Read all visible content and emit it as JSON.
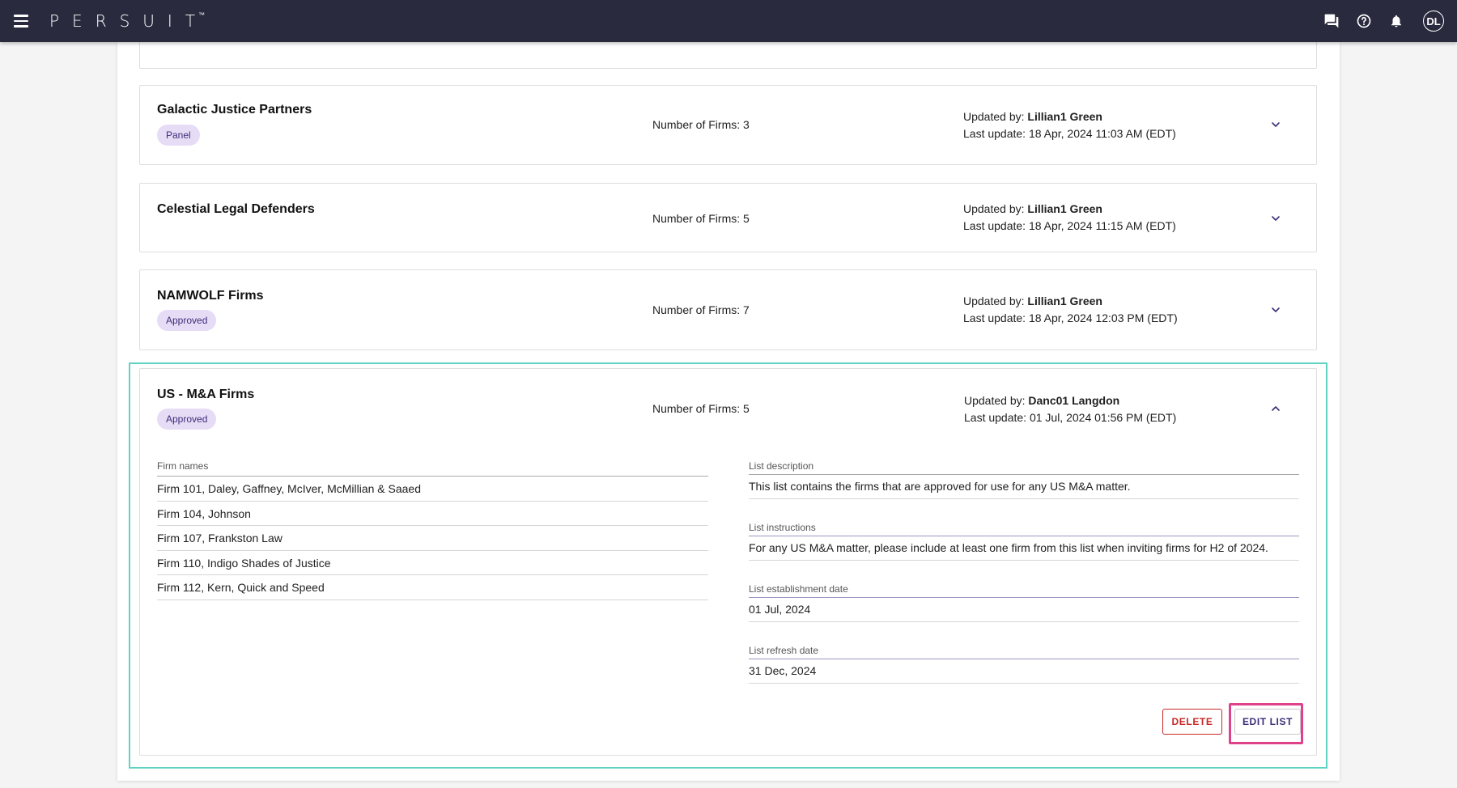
{
  "app": {
    "logo": "PERSUIT",
    "trademark": "™",
    "user_initials": "DL"
  },
  "icons": {
    "menu": "hamburger-menu-icon",
    "chat": "chat-icon",
    "help": "help-icon",
    "notifications": "bell-icon",
    "expand": "chevron-down-icon",
    "collapse": "chevron-up-icon"
  },
  "lists": [
    {
      "title": "Galactic Justice Partners",
      "badge": "Panel",
      "firms_count": "Number of Firms: 3",
      "updated_by_label": "Updated by:",
      "updated_by": "Lillian1 Green",
      "last_update": "Last update: 18 Apr, 2024 11:03 AM (EDT)"
    },
    {
      "title": "Celestial Legal Defenders",
      "firms_count": "Number of Firms: 5",
      "updated_by_label": "Updated by:",
      "updated_by": "Lillian1 Green",
      "last_update": "Last update: 18 Apr, 2024 11:15 AM (EDT)"
    },
    {
      "title": "NAMWOLF Firms",
      "badge": "Approved",
      "firms_count": "Number of Firms: 7",
      "updated_by_label": "Updated by:",
      "updated_by": "Lillian1 Green",
      "last_update": "Last update: 18 Apr, 2024 12:03 PM (EDT)"
    },
    {
      "title": "US - M&A Firms",
      "badge": "Approved",
      "firms_count": "Number of Firms: 5",
      "updated_by_label": "Updated by:",
      "updated_by": "Danc01 Langdon",
      "last_update": "Last update: 01 Jul, 2024 01:56 PM (EDT)"
    }
  ],
  "expanded": {
    "firm_names_label": "Firm names",
    "firms": [
      "Firm 101, Daley, Gaffney, McIver, McMillian & Saaed",
      "Firm 104, Johnson",
      "Firm 107, Frankston Law",
      "Firm 110, Indigo Shades of Justice",
      "Firm 112, Kern, Quick and Speed"
    ],
    "description_label": "List description",
    "description": "This list contains the firms that are approved for use for any US M&A matter.",
    "instructions_label": "List instructions",
    "instructions": "For any US M&A matter, please include at least one firm from this list when inviting firms for H2 of 2024.",
    "establishment_label": "List establishment date",
    "establishment_date": "01 Jul, 2024",
    "refresh_label": "List refresh date",
    "refresh_date": "31 Dec, 2024",
    "delete_label": "DELETE",
    "edit_label": "EDIT LIST"
  },
  "colors": {
    "topbar": "#2a2a3f",
    "badge_bg": "#e6dcf6",
    "badge_text": "#3d2d78",
    "selection_outline": "#5fd3c4",
    "edit_highlight": "#e0418b",
    "delete": "#c62828"
  }
}
